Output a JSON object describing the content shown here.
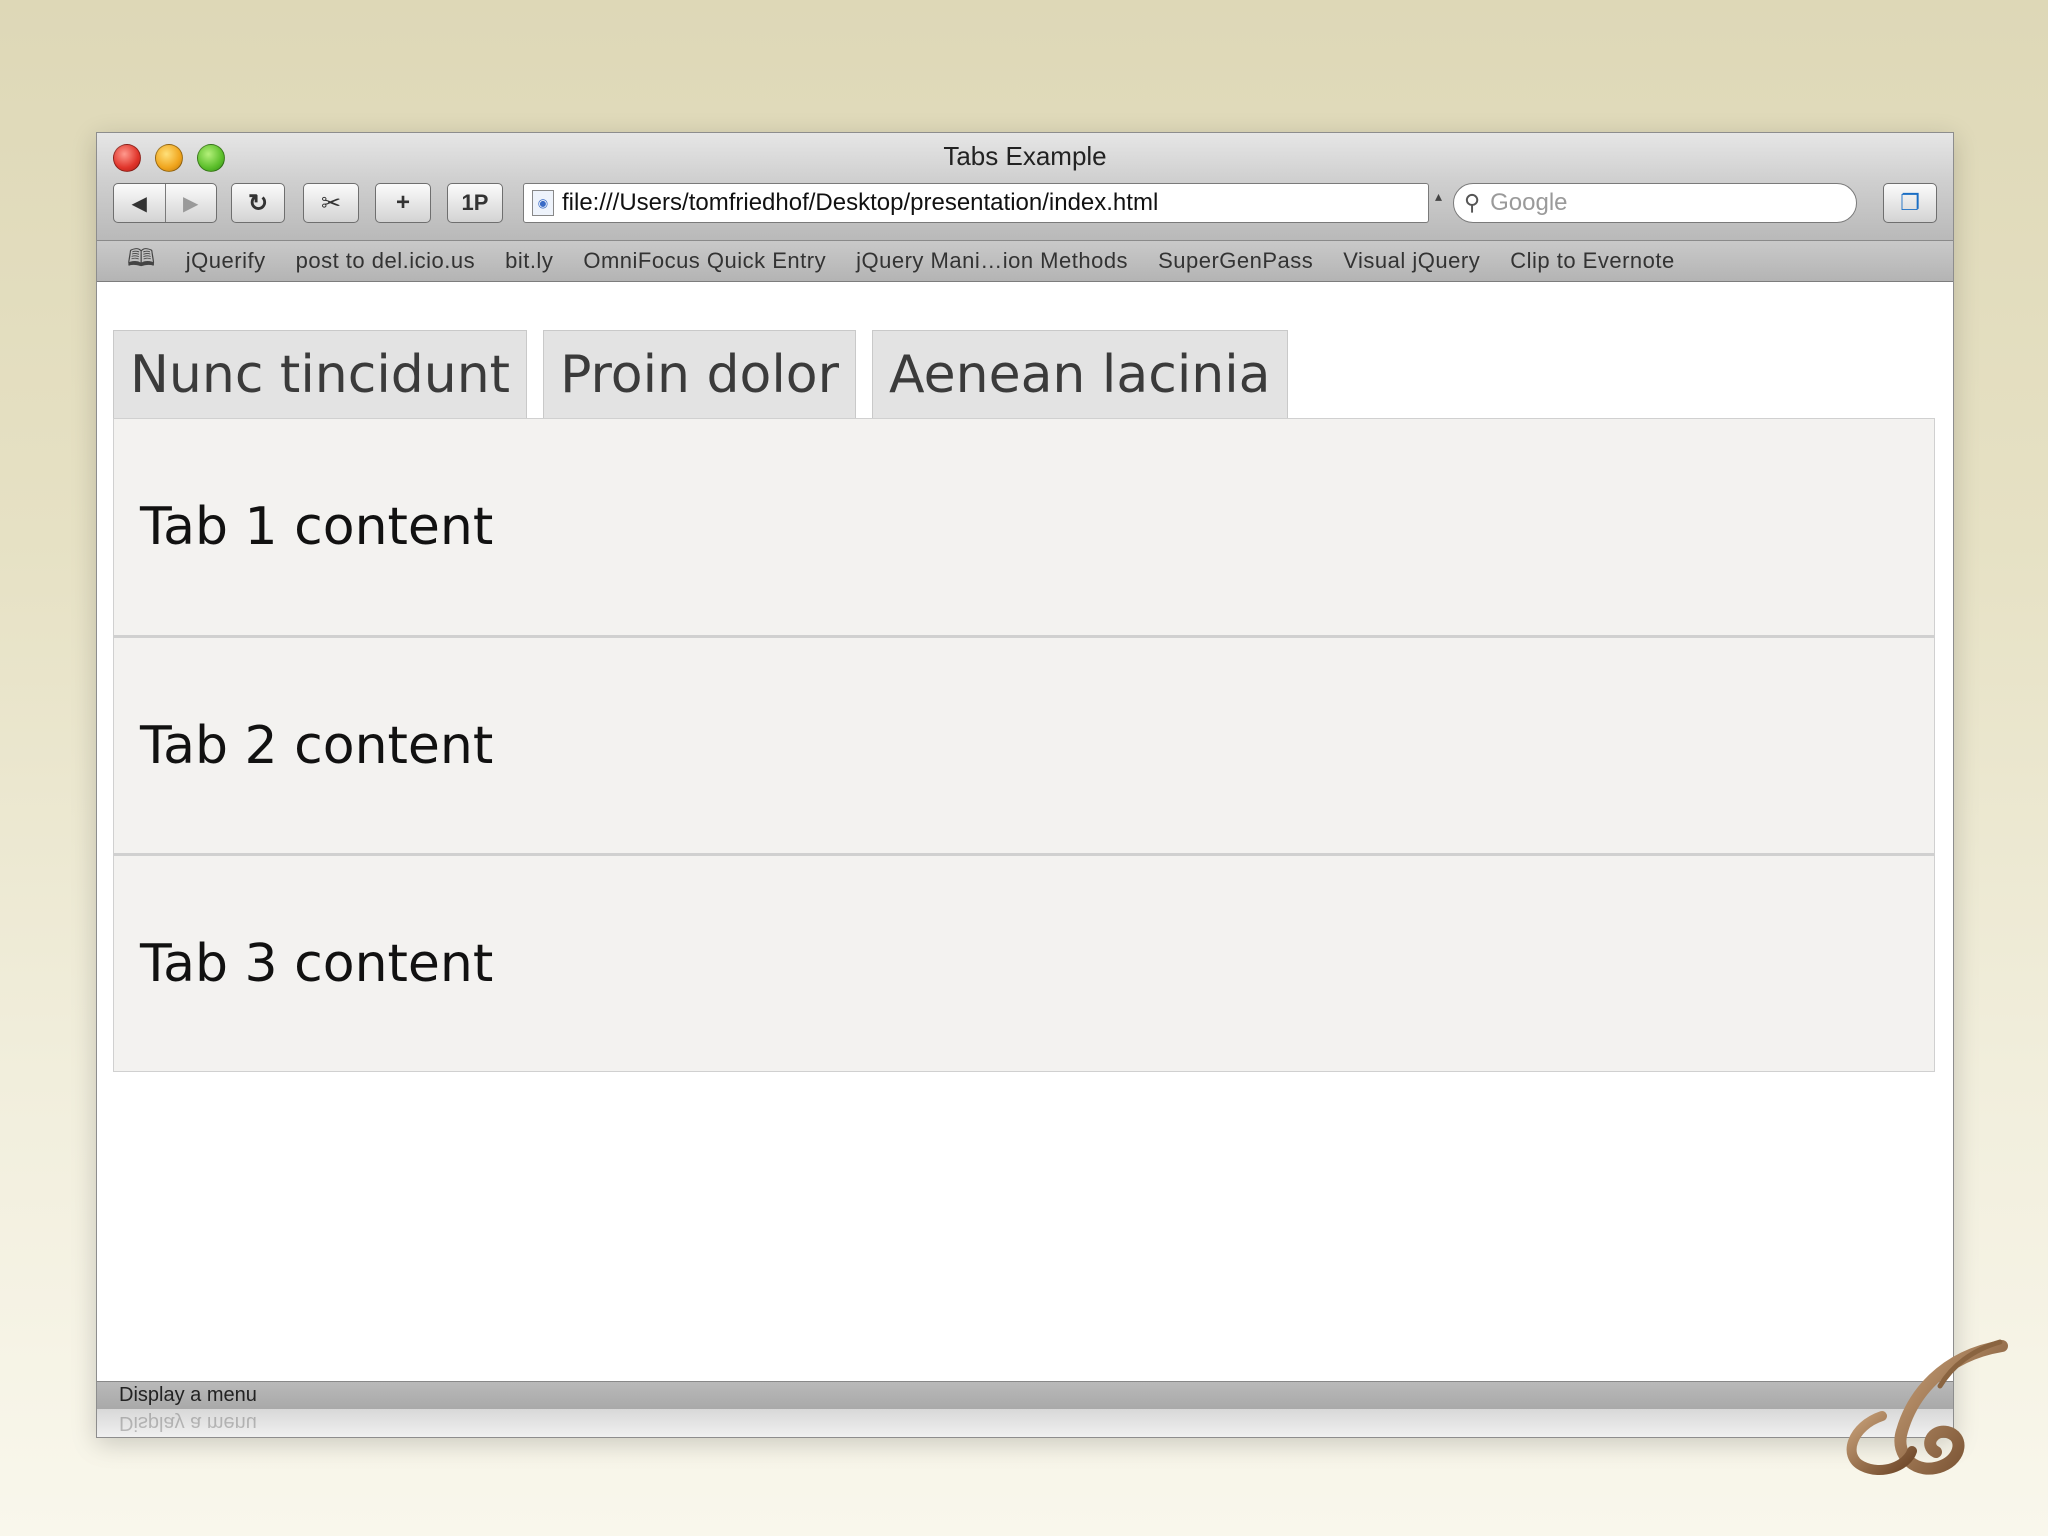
{
  "window": {
    "title": "Tabs Example"
  },
  "toolbar": {
    "back_label": "◀",
    "forward_label": "▶",
    "reload_label": "↻",
    "snip_label": "✂",
    "add_label": "+",
    "onepassword_label": "1P",
    "address_value": "file:///Users/tomfriedhof/Desktop/presentation/index.html",
    "search_placeholder": "Google"
  },
  "bookmarks": [
    "jQuerify",
    "post to del.icio.us",
    "bit.ly",
    "OmniFocus Quick Entry",
    "jQuery Mani…ion Methods",
    "SuperGenPass",
    "Visual jQuery",
    "Clip to Evernote"
  ],
  "tabs": [
    {
      "label": "Nunc tincidunt"
    },
    {
      "label": "Proin dolor"
    },
    {
      "label": "Aenean lacinia"
    }
  ],
  "panels": [
    {
      "text": "Tab 1 content"
    },
    {
      "text": "Tab 2 content"
    },
    {
      "text": "Tab 3 content"
    }
  ],
  "statusbar": {
    "text": "Display a menu"
  },
  "colors": {
    "background": "#e2dcc0",
    "tab": "#e3e3e3",
    "panel": "#f3f2f0"
  }
}
